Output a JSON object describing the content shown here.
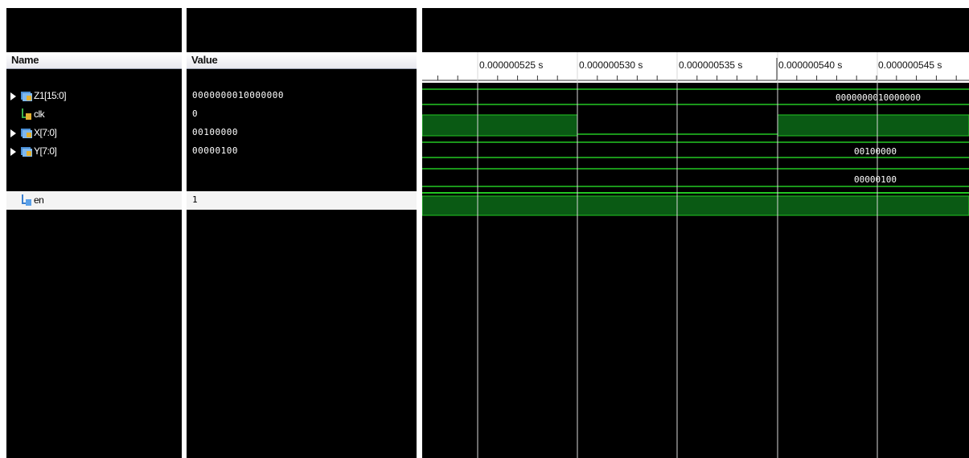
{
  "columns": {
    "name_header": "Name",
    "value_header": "Value"
  },
  "signals": [
    {
      "name": "Z1[15:0]",
      "value": "0000000010000000",
      "type": "bus",
      "icon": "bus-signal-icon",
      "expandable": true,
      "wave_label": "0000000010000000"
    },
    {
      "name": "clk",
      "value": "0",
      "type": "bit",
      "icon": "bit-signal-icon",
      "expandable": false
    },
    {
      "name": "X[7:0]",
      "value": "00100000",
      "type": "bus",
      "icon": "bus-signal-icon",
      "expandable": true,
      "wave_label": "00100000"
    },
    {
      "name": "Y[7:0]",
      "value": "00000100",
      "type": "bus",
      "icon": "bus-signal-icon",
      "expandable": true,
      "wave_label": "00000100"
    },
    {
      "name": "en",
      "value": "1",
      "type": "bit",
      "icon": "bit-signal-icon",
      "expandable": false,
      "selected": true
    }
  ],
  "timeline": {
    "ticks": [
      "0.000000525 s",
      "0.000000530 s",
      "0.000000535 s",
      "0.000000540 s",
      "0.000000545 s"
    ],
    "clk_wave": [
      {
        "from": "start",
        "to": "0.000000530 s",
        "level": 1
      },
      {
        "from": "0.000000530 s",
        "to": "0.000000540 s",
        "level": 0
      },
      {
        "from": "0.000000540 s",
        "to": "end",
        "level": 1
      }
    ],
    "en_level": 1
  },
  "colors": {
    "background": "#000000",
    "wave": "#22c722",
    "wave_fill": "#0a5a14",
    "cursor": "#d8d8d8",
    "selected_row": "#f4f4f4"
  }
}
